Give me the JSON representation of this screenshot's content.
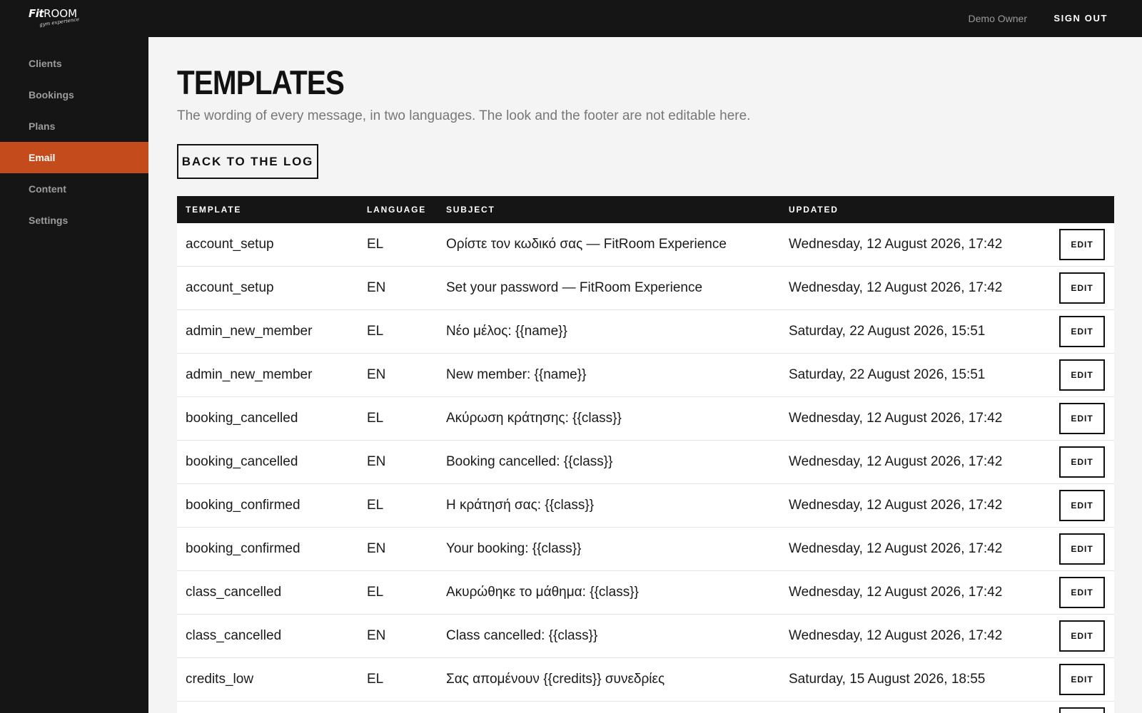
{
  "app": {
    "logo_text": "Fit",
    "logo_text_2": "ROOM",
    "logo_tagline": "gym experience"
  },
  "header": {
    "user_name": "Demo Owner",
    "signout_label": "SIGN OUT"
  },
  "sidebar": {
    "items": [
      {
        "label": "Clients",
        "active": false
      },
      {
        "label": "Bookings",
        "active": false
      },
      {
        "label": "Plans",
        "active": false
      },
      {
        "label": "Email",
        "active": true
      },
      {
        "label": "Content",
        "active": false
      },
      {
        "label": "Settings",
        "active": false
      }
    ]
  },
  "page": {
    "title": "TEMPLATES",
    "subtitle": "The wording of every message, in two languages. The look and the footer are not editable here.",
    "back_label": "BACK TO THE LOG"
  },
  "table": {
    "columns": [
      "TEMPLATE",
      "LANGUAGE",
      "SUBJECT",
      "UPDATED"
    ],
    "edit_label": "EDIT",
    "rows": [
      {
        "template": "account_setup",
        "language": "EL",
        "subject": "Ορίστε τον κωδικό σας — FitRoom Experience",
        "updated": "Wednesday, 12 August 2026, 17:42"
      },
      {
        "template": "account_setup",
        "language": "EN",
        "subject": "Set your password — FitRoom Experience",
        "updated": "Wednesday, 12 August 2026, 17:42"
      },
      {
        "template": "admin_new_member",
        "language": "EL",
        "subject": "Νέο μέλος: {{name}}",
        "updated": "Saturday, 22 August 2026, 15:51"
      },
      {
        "template": "admin_new_member",
        "language": "EN",
        "subject": "New member: {{name}}",
        "updated": "Saturday, 22 August 2026, 15:51"
      },
      {
        "template": "booking_cancelled",
        "language": "EL",
        "subject": "Ακύρωση κράτησης: {{class}}",
        "updated": "Wednesday, 12 August 2026, 17:42"
      },
      {
        "template": "booking_cancelled",
        "language": "EN",
        "subject": "Booking cancelled: {{class}}",
        "updated": "Wednesday, 12 August 2026, 17:42"
      },
      {
        "template": "booking_confirmed",
        "language": "EL",
        "subject": "Η κράτησή σας: {{class}}",
        "updated": "Wednesday, 12 August 2026, 17:42"
      },
      {
        "template": "booking_confirmed",
        "language": "EN",
        "subject": "Your booking: {{class}}",
        "updated": "Wednesday, 12 August 2026, 17:42"
      },
      {
        "template": "class_cancelled",
        "language": "EL",
        "subject": "Ακυρώθηκε το μάθημα: {{class}}",
        "updated": "Wednesday, 12 August 2026, 17:42"
      },
      {
        "template": "class_cancelled",
        "language": "EN",
        "subject": "Class cancelled: {{class}}",
        "updated": "Wednesday, 12 August 2026, 17:42"
      },
      {
        "template": "credits_low",
        "language": "EL",
        "subject": "Σας απομένουν {{credits}} συνεδρίες",
        "updated": "Saturday, 15 August 2026, 18:55"
      },
      {
        "template": "",
        "language": "",
        "subject": "",
        "updated": ""
      }
    ]
  },
  "colors": {
    "accent": "#c44b1c",
    "dark": "#151515"
  }
}
